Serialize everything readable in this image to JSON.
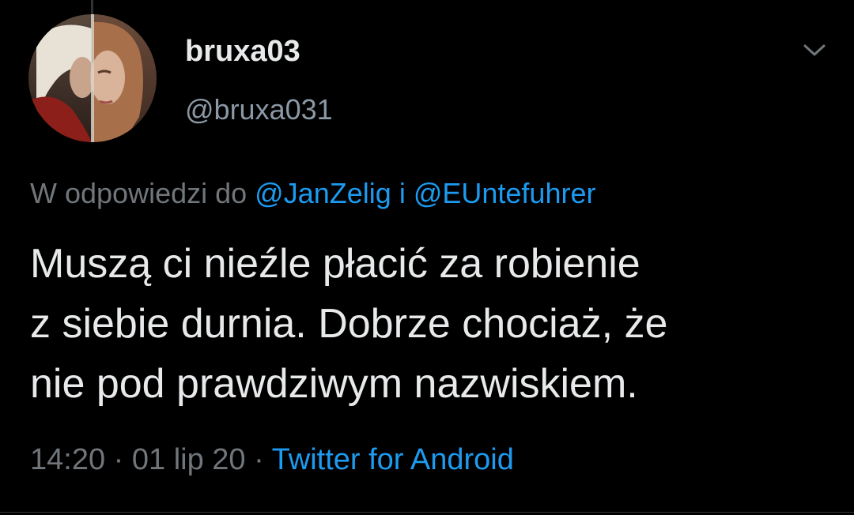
{
  "author": {
    "display_name": "bruxa03",
    "handle": "@bruxa031"
  },
  "menu": {
    "icon": "chevron-down-icon"
  },
  "reply": {
    "prefix": "W odpowiedzi do",
    "mention_1": "@JanZelig",
    "conjunction": "i",
    "mention_2": "@EUntefuhrer"
  },
  "tweet": {
    "line_1": "Muszą ci nieźle płacić za robienie",
    "line_2": "z siebie durnia. Dobrze chociaż, że",
    "line_3": "nie pod prawdziwym nazwiskiem."
  },
  "meta": {
    "time": "14:20",
    "date": "01 lip 20",
    "separator": "·",
    "source": "Twitter for Android"
  },
  "colors": {
    "background": "#000000",
    "text": "#e7e9ea",
    "muted": "#71767b",
    "link": "#1d9bf0"
  }
}
